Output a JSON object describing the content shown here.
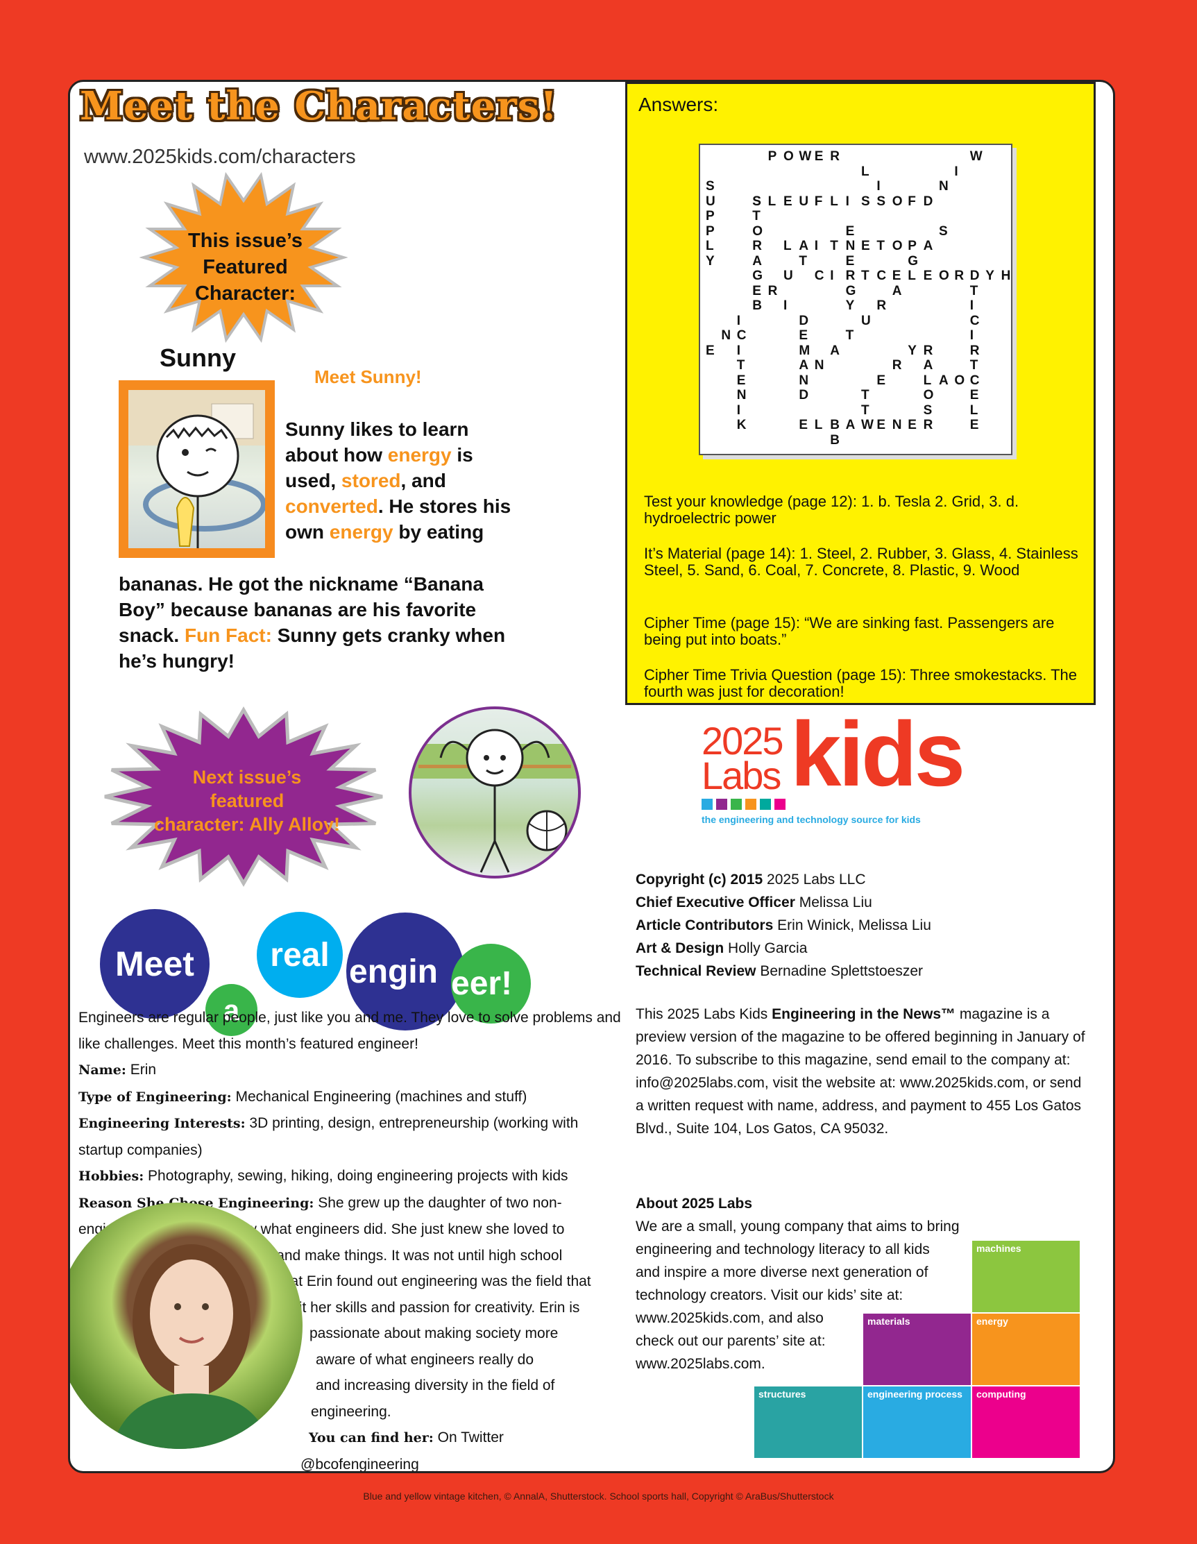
{
  "header": {
    "title": "Meet the Characters!",
    "url": "www.2025kids.com/characters"
  },
  "featured": {
    "burst_line1": "This issue’s",
    "burst_line2": "Featured Character:",
    "name": "Sunny",
    "meet": "Meet Sunny!",
    "text": [
      {
        "t": "Sunny likes to learn about how ",
        "c": ""
      },
      {
        "t": "energy",
        "c": "or"
      },
      {
        "t": " is used, ",
        "c": ""
      },
      {
        "t": "stored",
        "c": "or"
      },
      {
        "t": ", and ",
        "c": ""
      },
      {
        "t": "converted",
        "c": "or"
      },
      {
        "t": ". He stores his own ",
        "c": ""
      },
      {
        "t": "energy",
        "c": "or"
      },
      {
        "t": " by eating",
        "c": ""
      }
    ],
    "text2": [
      {
        "t": "bananas. He got the nickname “Banana Boy” because bananas are his favorite snack. ",
        "c": ""
      },
      {
        "t": "Fun Fact:",
        "c": "or"
      },
      {
        "t": " Sunny gets cranky when he’s hungry!",
        "c": ""
      }
    ]
  },
  "next_issue": {
    "line1": "Next issue’s featured",
    "line2": "character: Ally Alloy!"
  },
  "meet_engineer": {
    "w1": "Meet",
    "w2": "a",
    "w3": "real",
    "w4a": "engin",
    "w4b": "eer!"
  },
  "engineer": {
    "intro": "Engineers are regular people, just like you and me. They love to solve problems and like challenges. Meet this month’s featured engineer!",
    "fields": [
      {
        "label": "Name:",
        "value": " Erin"
      },
      {
        "label": "Type of Engineering:",
        "value": " Mechanical Engineering (machines and stuff)"
      },
      {
        "label": "Engineering Interests:",
        "value": " 3D printing, design, entrepreneurship (working with startup companies)"
      },
      {
        "label": "Hobbies:",
        "value": " Photography, sewing, hiking, doing engineering projects with kids"
      }
    ],
    "reason_label": "Reason She Chose Engineering:",
    "reason_lines": [
      " She grew up the daughter of two non-",
      "engineers and did not know what engineers did. She just knew she loved to",
      "build and make things. It was not until high school",
      "that Erin found out engineering was the field that",
      "fit her skills and passion for creativity. Erin is",
      "passionate about making society more",
      "aware of what engineers really do",
      "and increasing diversity in the field of",
      "engineering."
    ],
    "find_label": "You can find her:",
    "find_value": " On Twitter",
    "handle": "@bcofengineering"
  },
  "answers": {
    "heading": "Answers:",
    "crossword": [
      {
        "t": "POWER",
        "r": 0,
        "c": 4,
        "d": "a"
      },
      {
        "t": "W",
        "r": 0,
        "c": 17,
        "d": "a"
      },
      {
        "t": "L",
        "r": 1,
        "c": 10,
        "d": "a"
      },
      {
        "t": "I",
        "r": 1,
        "c": 16,
        "d": "a"
      },
      {
        "t": "I",
        "r": 2,
        "c": 11,
        "d": "a"
      },
      {
        "t": "N",
        "r": 2,
        "c": 15,
        "d": "a"
      },
      {
        "t": "SUPPLY",
        "r": 2,
        "c": 0,
        "d": "d"
      },
      {
        "t": "SLEUFLISSOF",
        "r": 3,
        "c": 3,
        "d": "a"
      },
      {
        "t": "D",
        "r": 3,
        "c": 14,
        "d": "a"
      },
      {
        "t": "STORAGE",
        "r": 3,
        "c": 3,
        "d": "d"
      },
      {
        "t": "E",
        "r": 5,
        "c": 9,
        "d": "a"
      },
      {
        "t": "S",
        "r": 5,
        "c": 15,
        "d": "a"
      },
      {
        "t": "LAITNETOP",
        "r": 6,
        "c": 5,
        "d": "a"
      },
      {
        "t": "A",
        "r": 6,
        "c": 14,
        "d": "a"
      },
      {
        "t": "T",
        "r": 7,
        "c": 6,
        "d": "a"
      },
      {
        "t": "E",
        "r": 7,
        "c": 9,
        "d": "a"
      },
      {
        "t": "G",
        "r": 7,
        "c": 13,
        "d": "a"
      },
      {
        "t": "U",
        "r": 8,
        "c": 5,
        "d": "a"
      },
      {
        "t": "CIRTCELEORDYH",
        "r": 8,
        "c": 7,
        "d": "a"
      },
      {
        "t": "ER",
        "r": 9,
        "c": 3,
        "d": "a"
      },
      {
        "t": "G",
        "r": 9,
        "c": 9,
        "d": "a"
      },
      {
        "t": "A",
        "r": 9,
        "c": 12,
        "d": "a"
      },
      {
        "t": "T",
        "r": 9,
        "c": 17,
        "d": "a"
      },
      {
        "t": "B",
        "r": 10,
        "c": 3,
        "d": "a"
      },
      {
        "t": "I",
        "r": 10,
        "c": 5,
        "d": "a"
      },
      {
        "t": "Y",
        "r": 10,
        "c": 9,
        "d": "a"
      },
      {
        "t": "R",
        "r": 10,
        "c": 11,
        "d": "a"
      },
      {
        "t": "I",
        "r": 10,
        "c": 17,
        "d": "a"
      },
      {
        "t": "I",
        "r": 11,
        "c": 2,
        "d": "a"
      },
      {
        "t": "D",
        "r": 11,
        "c": 6,
        "d": "a"
      },
      {
        "t": "U",
        "r": 11,
        "c": 10,
        "d": "a"
      },
      {
        "t": "C",
        "r": 11,
        "c": 17,
        "d": "a"
      },
      {
        "t": "NC",
        "r": 12,
        "c": 1,
        "d": "a"
      },
      {
        "t": "E",
        "r": 12,
        "c": 6,
        "d": "a"
      },
      {
        "t": "T",
        "r": 12,
        "c": 9,
        "d": "a"
      },
      {
        "t": "I",
        "r": 12,
        "c": 17,
        "d": "a"
      },
      {
        "t": "E",
        "r": 13,
        "c": 0,
        "d": "a"
      },
      {
        "t": "I",
        "r": 13,
        "c": 2,
        "d": "a"
      },
      {
        "t": "M",
        "r": 13,
        "c": 6,
        "d": "a"
      },
      {
        "t": "A",
        "r": 13,
        "c": 8,
        "d": "a"
      },
      {
        "t": "YR",
        "r": 13,
        "c": 13,
        "d": "a"
      },
      {
        "t": "R",
        "r": 13,
        "c": 17,
        "d": "a"
      },
      {
        "t": "T",
        "r": 14,
        "c": 2,
        "d": "a"
      },
      {
        "t": "AN",
        "r": 14,
        "c": 6,
        "d": "a"
      },
      {
        "t": "R",
        "r": 14,
        "c": 12,
        "d": "a"
      },
      {
        "t": "A",
        "r": 14,
        "c": 14,
        "d": "a"
      },
      {
        "t": "T",
        "r": 14,
        "c": 17,
        "d": "a"
      },
      {
        "t": "E",
        "r": 15,
        "c": 2,
        "d": "a"
      },
      {
        "t": "N",
        "r": 15,
        "c": 6,
        "d": "a"
      },
      {
        "t": "E",
        "r": 15,
        "c": 11,
        "d": "a"
      },
      {
        "t": "LAOC",
        "r": 15,
        "c": 14,
        "d": "a"
      },
      {
        "t": "N",
        "r": 16,
        "c": 2,
        "d": "a"
      },
      {
        "t": "D",
        "r": 16,
        "c": 6,
        "d": "a"
      },
      {
        "t": "T",
        "r": 16,
        "c": 10,
        "d": "a"
      },
      {
        "t": "O",
        "r": 16,
        "c": 14,
        "d": "a"
      },
      {
        "t": "E",
        "r": 16,
        "c": 17,
        "d": "a"
      },
      {
        "t": "I",
        "r": 17,
        "c": 2,
        "d": "a"
      },
      {
        "t": "T",
        "r": 17,
        "c": 10,
        "d": "a"
      },
      {
        "t": "S",
        "r": 17,
        "c": 14,
        "d": "a"
      },
      {
        "t": "L",
        "r": 17,
        "c": 17,
        "d": "a"
      },
      {
        "t": "K",
        "r": 18,
        "c": 2,
        "d": "a"
      },
      {
        "t": "ELBAWENER",
        "r": 18,
        "c": 6,
        "d": "a"
      },
      {
        "t": "E",
        "r": 18,
        "c": 17,
        "d": "a"
      },
      {
        "t": "B",
        "r": 19,
        "c": 8,
        "d": "a"
      }
    ],
    "paragraphs": [
      "Test your knowledge (page 12): 1. b. Tesla 2. Grid, 3. d. hydroelectric power",
      "It’s Material (page 14): 1. Steel, 2. Rubber, 3. Glass, 4. Stainless Steel, 5. Sand, 6. Coal, 7. Concrete, 8. Plastic, 9. Wood",
      "Cipher Time (page 15): “We are sinking fast. Passengers are being put into boats.”",
      "Cipher Time Trivia Question (page 15): Three smokestacks. The fourth was just for decoration!"
    ]
  },
  "logo": {
    "top": "2025",
    "mid": "Labs",
    "kids": "kids",
    "tagline": "the engineering and technology source for kids",
    "red": "#ee3a24",
    "swatches": [
      "#29abe2",
      "#92278f",
      "#39b54a",
      "#f7941d",
      "#00a99d",
      "#ec008c"
    ]
  },
  "credits": [
    {
      "label": "Copyright (c) 2015",
      "value": " 2025 Labs LLC"
    },
    {
      "label": "Chief Executive Officer",
      "value": " Melissa Liu"
    },
    {
      "label": "Article Contributors",
      "value": " Erin Winick, Melissa Liu"
    },
    {
      "label": "Art & Design",
      "value": " Holly Garcia"
    },
    {
      "label": "Technical Review",
      "value": " Bernadine Splettstoeszer"
    }
  ],
  "magazine": {
    "pre": "This 2025 Labs Kids ",
    "bold": "Engineering in the News™",
    "post": " magazine is a preview version of the magazine to be offered beginning in January of 2016. To subscribe to this magazine, send email to the company at: info@2025labs.com, visit the website at: www.2025kids.com, or send a written request with name, address, and payment to 455 Los Gatos Blvd., Suite 104, Los Gatos, CA 95032."
  },
  "about": {
    "heading": "About 2025 Labs",
    "lines": [
      "We are a small, young company that aims to bring",
      "engineering and technology literacy to all  kids",
      "and inspire a more diverse next generation of",
      "technology creators. Visit our kids’ site at:",
      "www.2025kids.com, and also",
      "check out our parents’ site at:",
      "www.2025labs.com."
    ]
  },
  "tiles": [
    {
      "label": "machines",
      "color": "#8cc63f"
    },
    {
      "label": "materials",
      "color": "#92278f"
    },
    {
      "label": "energy",
      "color": "#f7941d"
    },
    {
      "label": "structures",
      "color": "#29a3a3"
    },
    {
      "label": "engineering process",
      "color": "#29abe2"
    },
    {
      "label": "computing",
      "color": "#ec008c"
    }
  ],
  "photo_credit": "Blue and yellow vintage kitchen, © AnnalA, Shutterstock. School sports hall, Copyright © AraBus/Shutterstock"
}
